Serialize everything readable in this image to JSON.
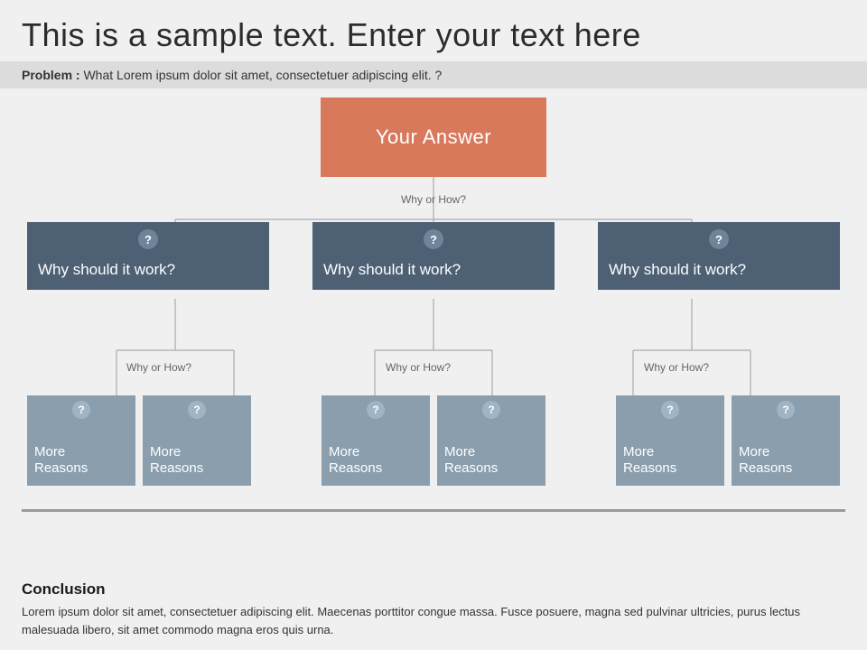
{
  "header": {
    "title": "This is a sample text. Enter your text here"
  },
  "problem": {
    "label": "Problem :",
    "text": "What Lorem ipsum dolor sit amet, consectetuer adipiscing elit. ?"
  },
  "diagram": {
    "root": {
      "label": "Your Answer"
    },
    "why_label_root": "Why or How?",
    "level1": [
      {
        "label": "Why should it work?",
        "why_label": "Why or How?"
      },
      {
        "label": "Why should it work?",
        "why_label": "Why or How?"
      },
      {
        "label": "Why should it work?",
        "why_label": "Why or How?"
      }
    ],
    "level2_groups": [
      [
        {
          "label": "More\nReasons"
        },
        {
          "label": "More\nReasons"
        }
      ],
      [
        {
          "label": "More\nReasons"
        },
        {
          "label": "More\nReasons"
        }
      ],
      [
        {
          "label": "More\nReasons"
        },
        {
          "label": "More\nReasons"
        }
      ]
    ]
  },
  "conclusion": {
    "title": "Conclusion",
    "text": "Lorem ipsum dolor sit amet, consectetuer adipiscing elit. Maecenas porttitor congue massa. Fusce posuere, magna sed pulvinar ultricies, purus lectus malesuada libero, sit amet commodo magna eros quis urna."
  },
  "icons": {
    "question_mark": "?"
  }
}
